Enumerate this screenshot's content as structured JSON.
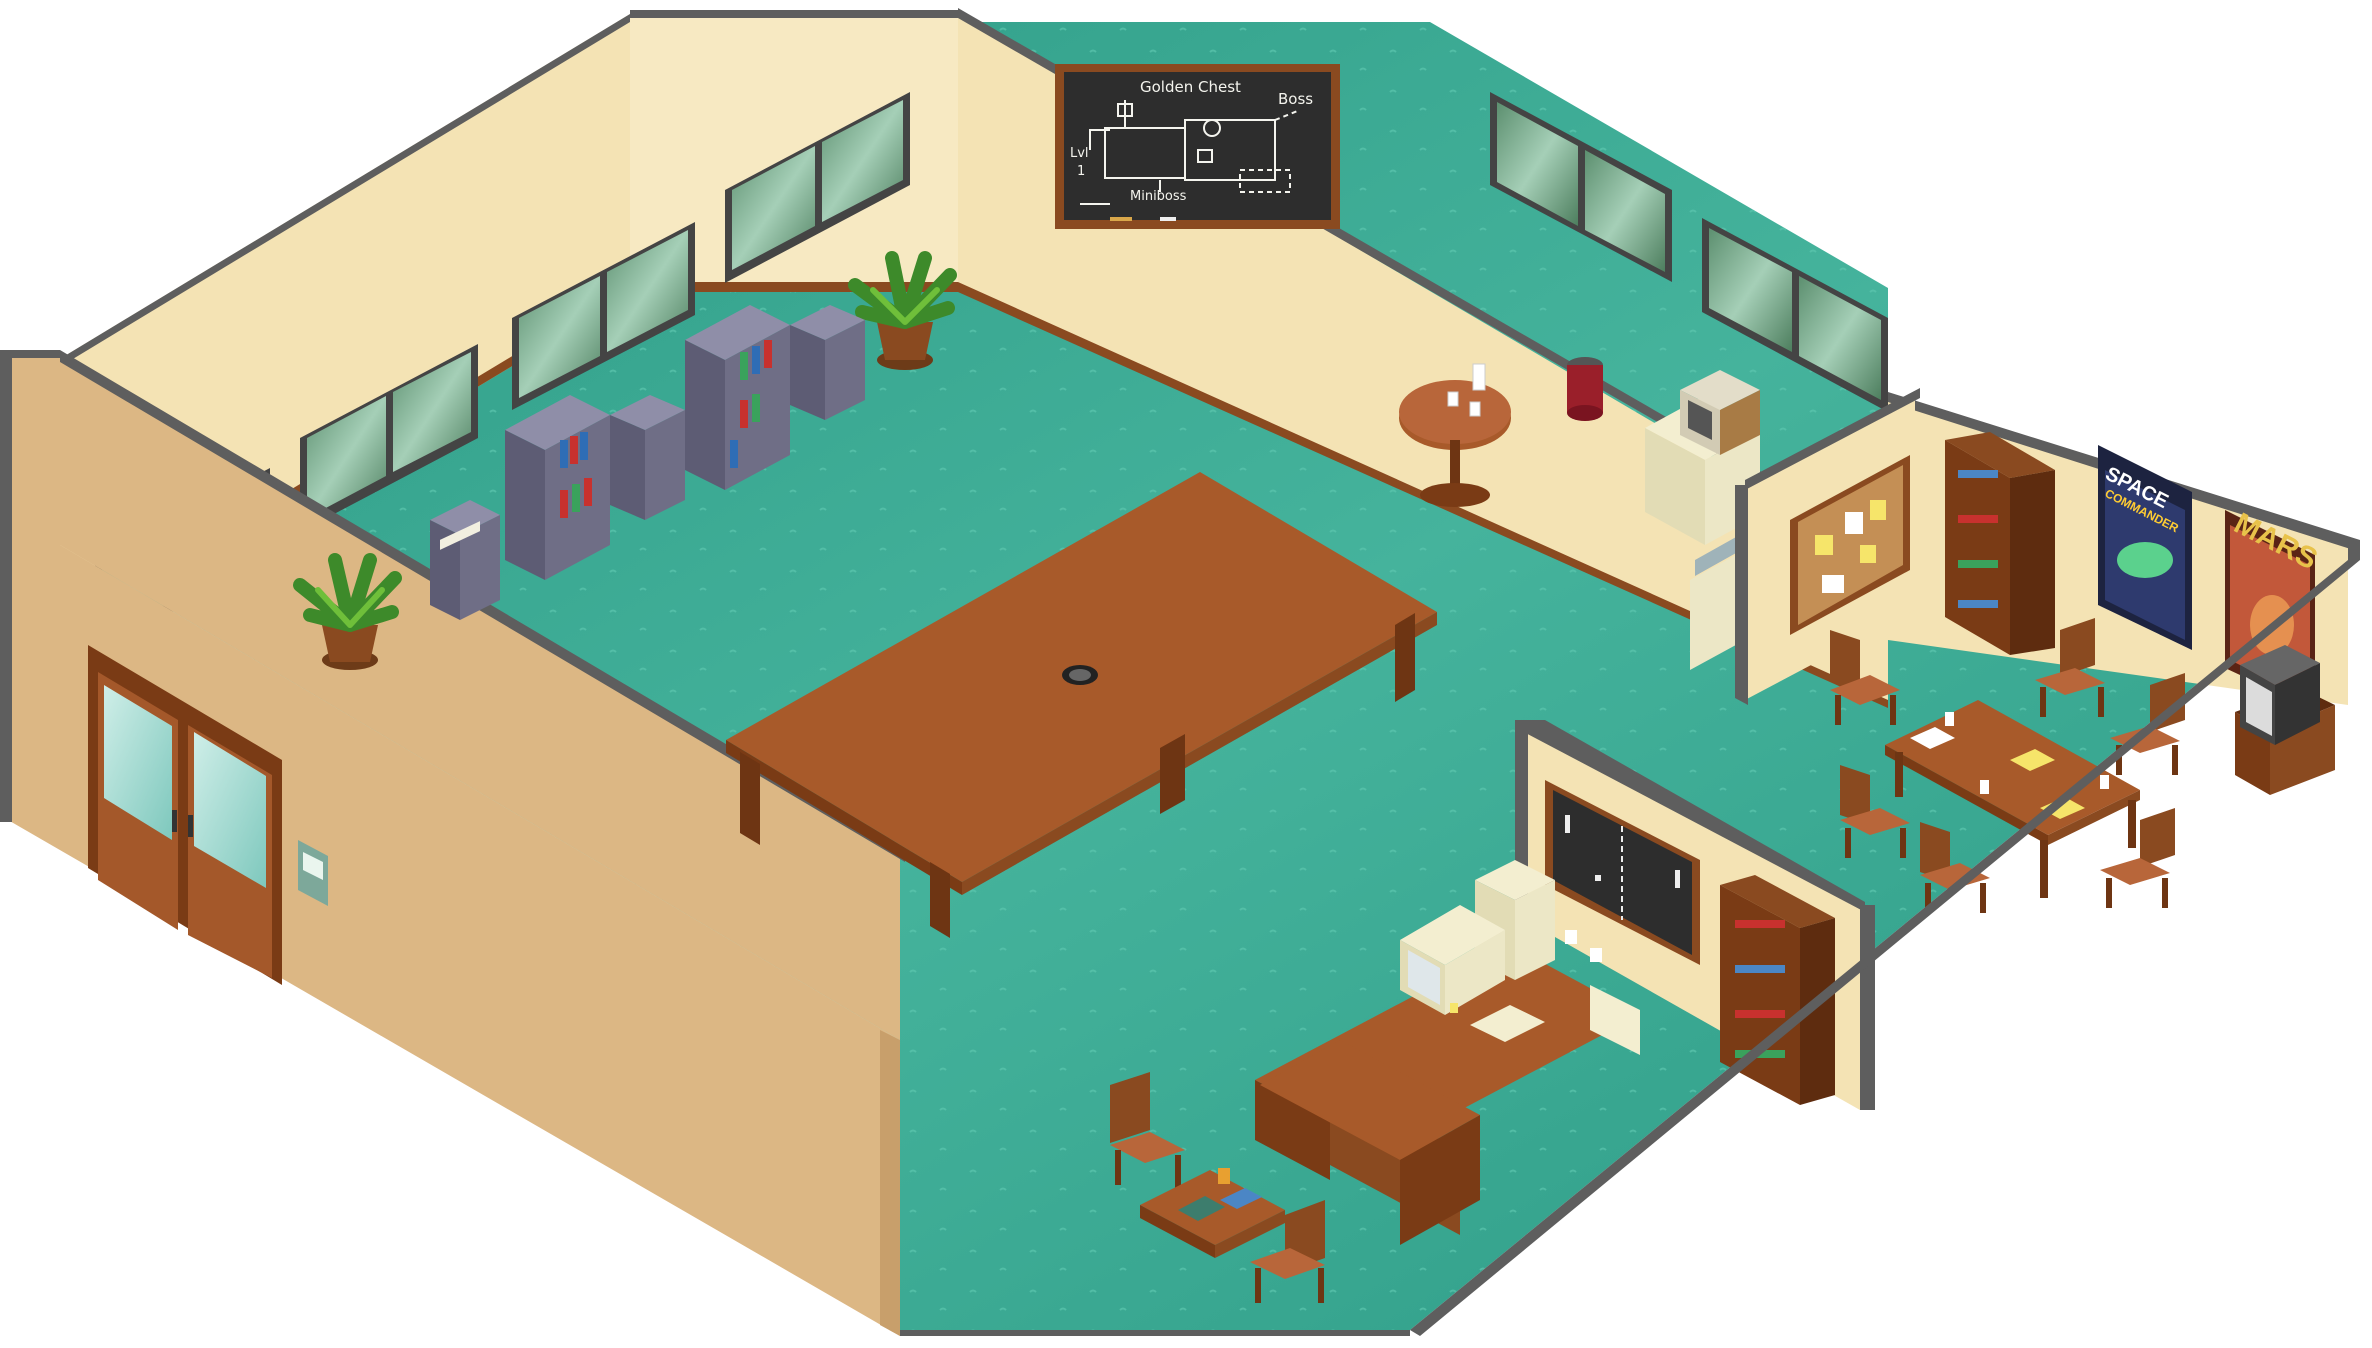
{
  "scene": {
    "title": "",
    "colors": {
      "carpet": "#2f9e88",
      "carpet_light": "#4cbba3",
      "wall": "#f4e3b4",
      "outer_wall": "#dcb784",
      "wall_trim": "#5e5e5e",
      "wood": "#9a4f22",
      "wood_dark": "#6e3513",
      "chalkboard": "#2d2d2d",
      "cabinet": "#6f6e86"
    }
  },
  "chalkboard": {
    "title": "Golden Chest",
    "boss": "Boss",
    "level_line1": "Lvl",
    "level_line2": "1",
    "miniboss": "Miniboss"
  },
  "posters": {
    "space_line1": "SPACE",
    "space_line2": "COMMANDER",
    "mars": "MARS"
  },
  "furniture": {
    "icons": [
      "door-icon",
      "thermostat-icon",
      "plant-icon",
      "file-cabinet-icon",
      "bookshelf-icon",
      "conference-table-icon",
      "microwave-icon",
      "trash-can-icon",
      "computer-icon",
      "tv-icon",
      "cork-board-icon",
      "chair-icon"
    ]
  }
}
